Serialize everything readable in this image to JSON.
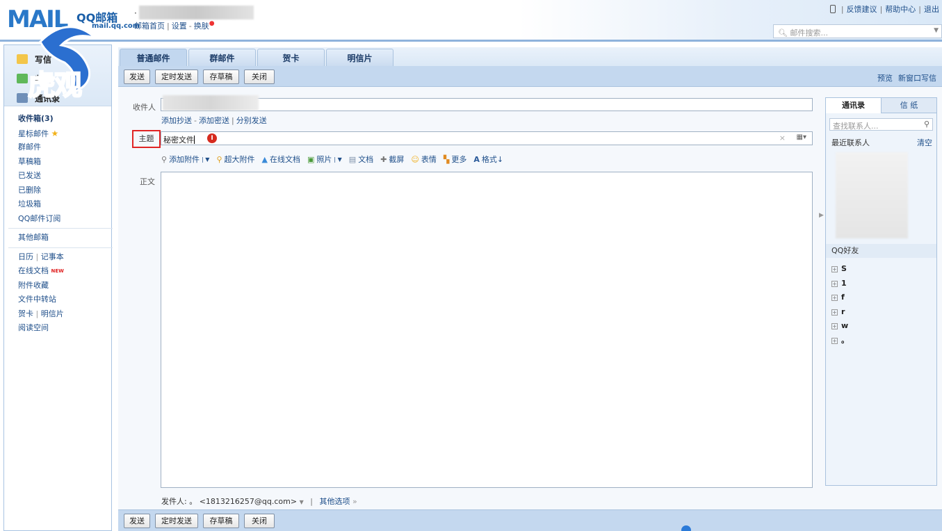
{
  "header": {
    "logo_mail": "MAIL",
    "logo_brand": "QQ邮箱",
    "logo_domain": "mail.qq.com",
    "user_dot": "·",
    "links": [
      "邮箱首页",
      "设置",
      "换肤"
    ],
    "top_right": [
      "反馈建议",
      "帮助中心",
      "退出"
    ],
    "search_placeholder": "邮件搜索..."
  },
  "watermark": {
    "text": "虎观"
  },
  "sidebar": {
    "top_items": [
      "写信",
      "收信",
      "通讯录"
    ],
    "folders": [
      {
        "label": "收件箱(3)",
        "bold": true
      },
      {
        "label": "星标邮件",
        "star": true
      },
      {
        "label": "群邮件"
      },
      {
        "label": "草稿箱"
      },
      {
        "label": "已发送"
      },
      {
        "label": "已删除"
      },
      {
        "label": "垃圾箱"
      },
      {
        "label": "QQ邮件订阅"
      }
    ],
    "other_mailbox": "其他邮箱",
    "tools": [
      "日历",
      "记事本"
    ],
    "online_docs": "在线文档",
    "new_badge": "NEW",
    "attachments": "附件收藏",
    "transfer": "文件中转站",
    "cards": [
      "贺卡",
      "明信片"
    ],
    "reading": "阅读空间"
  },
  "tabs": [
    "普通邮件",
    "群邮件",
    "贺卡",
    "明信片"
  ],
  "toolbar": {
    "send": "发送",
    "scheduled": "定时发送",
    "save_draft": "存草稿",
    "close": "关闭",
    "preview": "预览",
    "new_window": "新窗口写信"
  },
  "compose": {
    "to_label": "收件人",
    "cc_links": [
      "添加抄送",
      "添加密送",
      "分别发送"
    ],
    "subject_label": "主题",
    "subject_value": "秘密文件",
    "cursor_badge": "I",
    "body_label": "正文",
    "format_items": [
      "添加附件",
      "超大附件",
      "在线文档",
      "照片",
      "文档",
      "截屏",
      "表情",
      "更多",
      "格式"
    ],
    "sender_label": "发件人:",
    "sender_name": "。",
    "sender_email": "<1813216257@qq.com>",
    "other_options": "其他选项"
  },
  "contacts": {
    "tabs": [
      "通讯录",
      "信 纸"
    ],
    "search_placeholder": "查找联系人...",
    "recent": "最近联系人",
    "clear": "清空",
    "qq_friends": "QQ好友",
    "groups": [
      "S",
      "1",
      "f",
      "r",
      "w",
      "。"
    ]
  }
}
